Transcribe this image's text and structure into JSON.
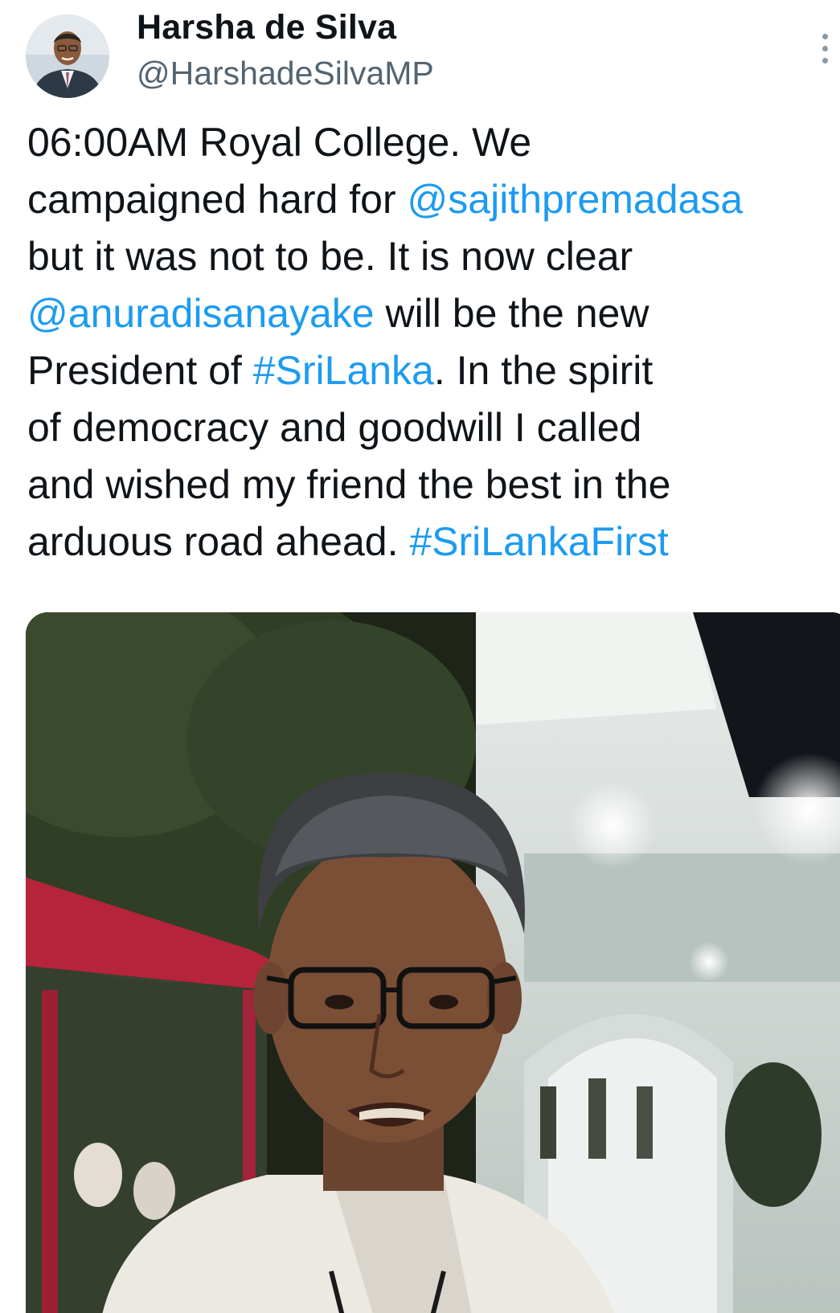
{
  "author": {
    "display_name": "Harsha de Silva",
    "handle": "@HarshadeSilvaMP",
    "avatar_icon": "profile-photo"
  },
  "more_icon": "more-vertical-icon",
  "tweet": {
    "line1": "06:00AM Royal College. We",
    "line2_pre": "campaigned hard for ",
    "mention1": "@sajithpremadasa",
    "line3": "but it was not to be. It is now clear",
    "mention2": "@anuradisanayake",
    "line4_post": " will be the new",
    "line5_pre": "President of ",
    "hashtag1": "#SriLanka",
    "line5_post": ". In the spirit",
    "line6": "of democracy and goodwill I called",
    "line7": "and wished my friend the best in the",
    "line8_pre": "arduous road ahead. ",
    "hashtag2": "#SriLankaFirst"
  },
  "media": {
    "type": "photo"
  },
  "colors": {
    "text": "#0f1419",
    "link": "#1d9bf0",
    "secondary": "#536471"
  }
}
